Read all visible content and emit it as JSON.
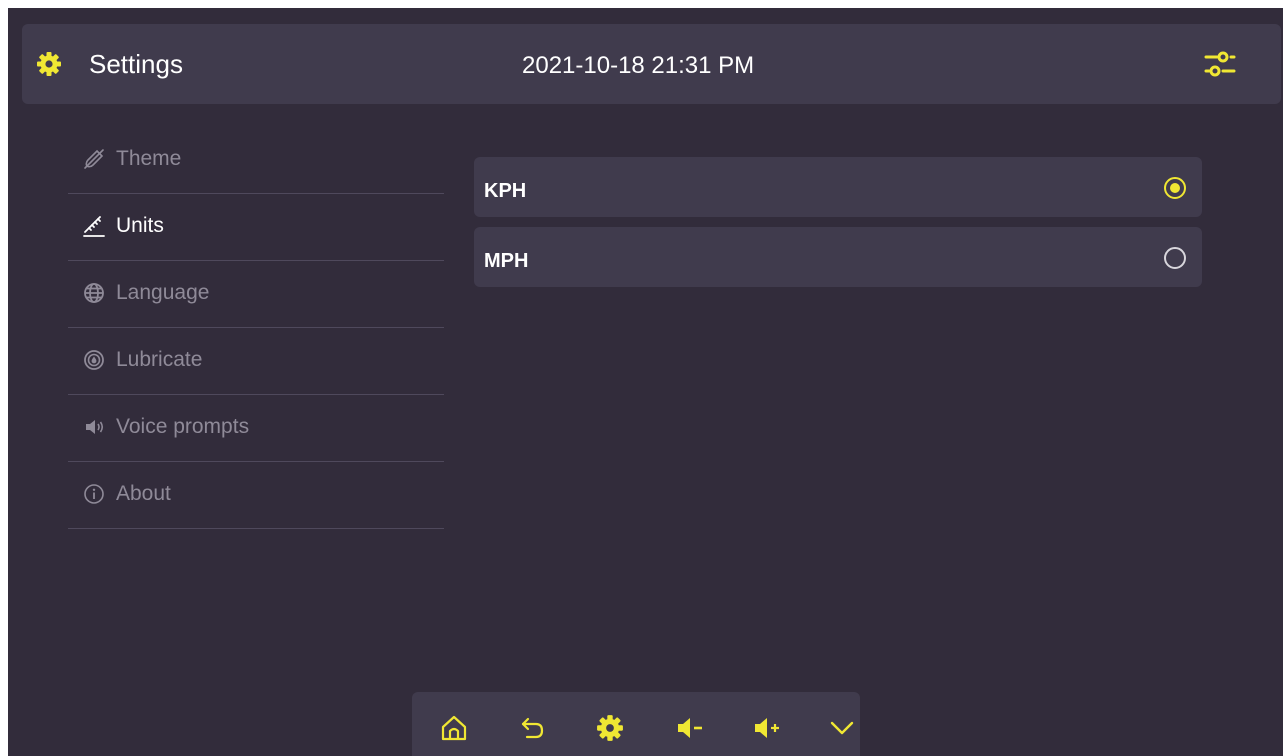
{
  "header": {
    "title": "Settings",
    "datetime": "2021-10-18 21:31 PM",
    "icon": "gear-icon",
    "action_icon": "sliders-icon"
  },
  "sidebar": {
    "items": [
      {
        "label": "Theme",
        "icon": "brush-icon",
        "active": false
      },
      {
        "label": "Units",
        "icon": "ruler-icon",
        "active": true
      },
      {
        "label": "Language",
        "icon": "globe-icon",
        "active": false
      },
      {
        "label": "Lubricate",
        "icon": "drop-icon",
        "active": false
      },
      {
        "label": "Voice prompts",
        "icon": "speaker-icon",
        "active": false
      },
      {
        "label": "About",
        "icon": "info-icon",
        "active": false
      }
    ]
  },
  "units": {
    "options": [
      {
        "label": "KPH",
        "selected": true
      },
      {
        "label": "MPH",
        "selected": false
      }
    ]
  },
  "bottombar": {
    "buttons": [
      "home-icon",
      "back-icon",
      "gear-icon",
      "volume-down-icon",
      "volume-up-icon",
      "chevron-down-icon"
    ]
  },
  "colors": {
    "background": "#322c3b",
    "panel": "#403b4d",
    "accent": "#f0e733",
    "text_active": "#ffffff",
    "text_muted": "#8f8a98"
  }
}
